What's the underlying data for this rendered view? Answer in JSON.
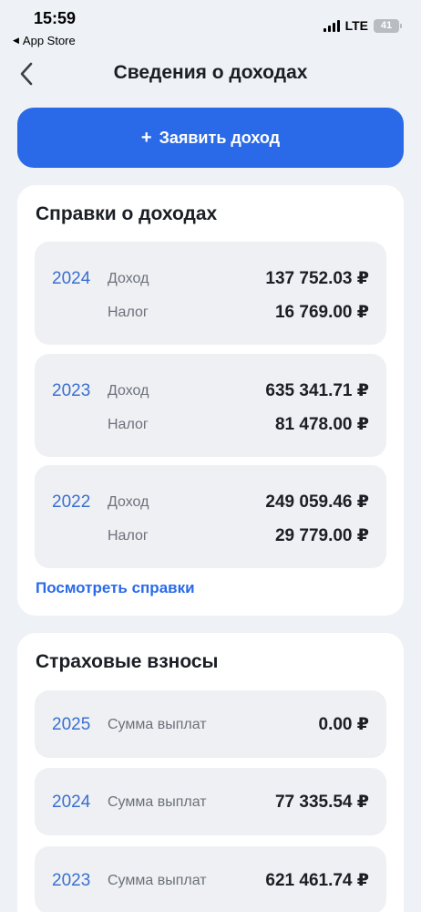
{
  "status_bar": {
    "time": "15:59",
    "back_app": "App Store",
    "network": "LTE",
    "battery": "41"
  },
  "header": {
    "title": "Сведения о доходах"
  },
  "declare_button": {
    "plus": "+",
    "label": "Заявить доход"
  },
  "income_section": {
    "title": "Справки о доходах",
    "rows": [
      {
        "year": "2024",
        "income_label": "Доход",
        "income": "137 752.03 ₽",
        "tax_label": "Налог",
        "tax": "16 769.00 ₽"
      },
      {
        "year": "2023",
        "income_label": "Доход",
        "income": "635 341.71 ₽",
        "tax_label": "Налог",
        "tax": "81 478.00 ₽"
      },
      {
        "year": "2022",
        "income_label": "Доход",
        "income": "249 059.46 ₽",
        "tax_label": "Налог",
        "tax": "29 779.00 ₽"
      }
    ],
    "link": "Посмотреть справки"
  },
  "insurance_section": {
    "title": "Страховые взносы",
    "rows": [
      {
        "year": "2025",
        "label": "Сумма выплат",
        "amount": "0.00 ₽"
      },
      {
        "year": "2024",
        "label": "Сумма выплат",
        "amount": "77 335.54 ₽"
      },
      {
        "year": "2023",
        "label": "Сумма выплат",
        "amount": "621 461.74 ₽"
      }
    ]
  },
  "colors": {
    "background": "#eef1f5",
    "accent": "#2a6ae8",
    "year_text": "#3a6fd0",
    "row_background": "#eff0f3"
  }
}
